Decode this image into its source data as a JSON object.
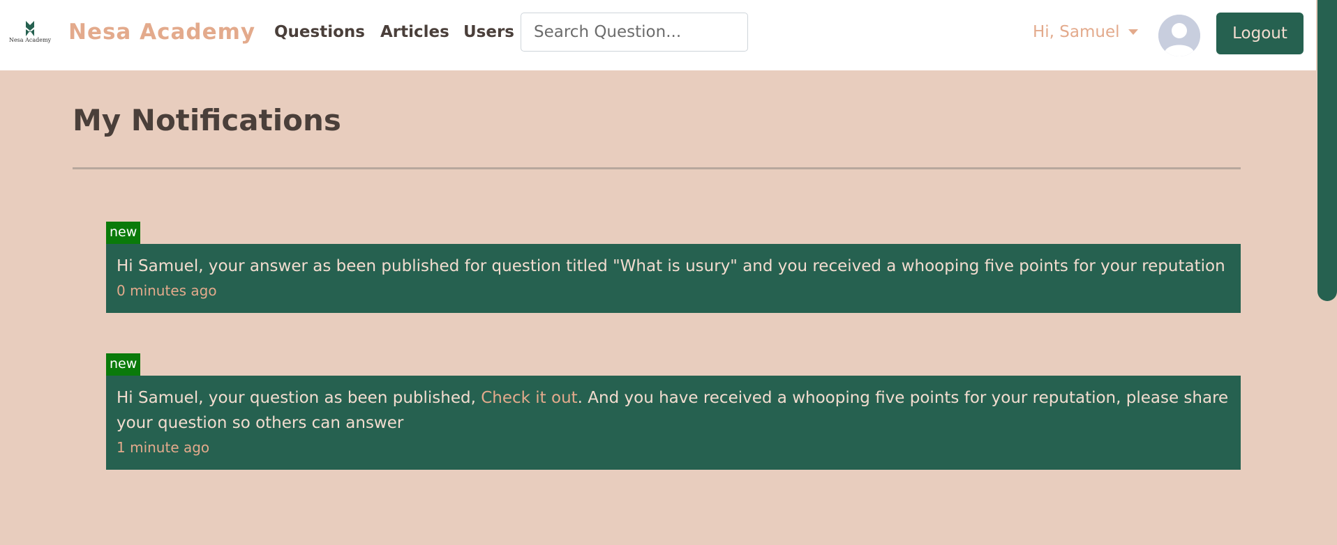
{
  "navbar": {
    "logo_text": "Nesa Academy",
    "brand": "Nesa Academy",
    "links": [
      "Questions",
      "Articles",
      "Users"
    ],
    "search_placeholder": "Search Question...",
    "user_greeting": "Hi, Samuel",
    "logout_label": "Logout"
  },
  "page": {
    "title": "My Notifications"
  },
  "notifications": [
    {
      "badge": "new",
      "message": "Hi Samuel, your answer as been published for question titled \"What is usury\" and you received a whooping five points for your reputation",
      "time": "0 minutes ago"
    },
    {
      "badge": "new",
      "message_before": "Hi Samuel, your question as been published, ",
      "link_text": "Check it out",
      "message_after": ". And you have received a whooping five points for your reputation, please share your question so others can answer",
      "time": "1 minute ago"
    }
  ],
  "colors": {
    "primary": "#266150",
    "accent": "#e3aa8c",
    "background": "#e8cdbe",
    "badge": "#0a7a0a"
  }
}
